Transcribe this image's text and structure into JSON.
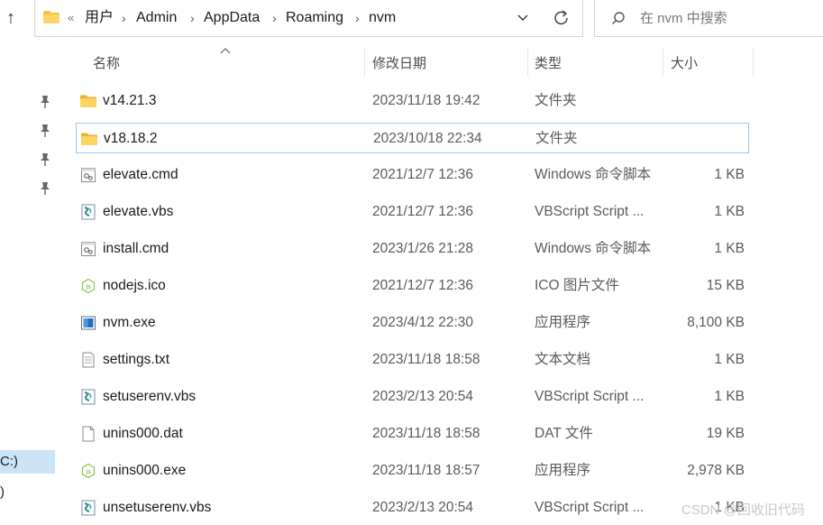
{
  "address": {
    "overflow": "«",
    "crumbs": [
      "用户",
      "Admin",
      "AppData",
      "Roaming",
      "nvm"
    ]
  },
  "search": {
    "placeholder": "在 nvm 中搜索"
  },
  "columns": {
    "name": "名称",
    "date": "修改日期",
    "type": "类型",
    "size": "大小"
  },
  "nav": {
    "drive_label": "C:)",
    "item2": ")"
  },
  "files": [
    {
      "name": "v14.21.3",
      "date": "2023/11/18 19:42",
      "type": "文件夹",
      "size": "",
      "icon": "folder-icon"
    },
    {
      "name": "v18.18.2",
      "date": "2023/10/18 22:34",
      "type": "文件夹",
      "size": "",
      "icon": "folder-icon"
    },
    {
      "name": "elevate.cmd",
      "date": "2021/12/7 12:36",
      "type": "Windows 命令脚本",
      "size": "1 KB",
      "icon": "cmd-file-icon"
    },
    {
      "name": "elevate.vbs",
      "date": "2021/12/7 12:36",
      "type": "VBScript Script ...",
      "size": "1 KB",
      "icon": "vbs-file-icon"
    },
    {
      "name": "install.cmd",
      "date": "2023/1/26 21:28",
      "type": "Windows 命令脚本",
      "size": "1 KB",
      "icon": "cmd-file-icon"
    },
    {
      "name": "nodejs.ico",
      "date": "2021/12/7 12:36",
      "type": "ICO 图片文件",
      "size": "15 KB",
      "icon": "nodejs-icon"
    },
    {
      "name": "nvm.exe",
      "date": "2023/4/12 22:30",
      "type": "应用程序",
      "size": "8,100 KB",
      "icon": "exe-icon"
    },
    {
      "name": "settings.txt",
      "date": "2023/11/18 18:58",
      "type": "文本文档",
      "size": "1 KB",
      "icon": "text-file-icon"
    },
    {
      "name": "setuserenv.vbs",
      "date": "2023/2/13 20:54",
      "type": "VBScript Script ...",
      "size": "1 KB",
      "icon": "vbs-file-icon"
    },
    {
      "name": "unins000.dat",
      "date": "2023/11/18 18:58",
      "type": "DAT 文件",
      "size": "19 KB",
      "icon": "blank-file-icon"
    },
    {
      "name": "unins000.exe",
      "date": "2023/11/18 18:57",
      "type": "应用程序",
      "size": "2,978 KB",
      "icon": "nodejs-icon"
    },
    {
      "name": "unsetuserenv.vbs",
      "date": "2023/2/13 20:54",
      "type": "VBScript Script ...",
      "size": "1 KB",
      "icon": "vbs-file-icon"
    }
  ],
  "watermark": "CSDN @回收旧代码",
  "colors": {
    "folder": "#f6c445",
    "selection_border": "#99c9ef",
    "nav_selected": "#cce4f7"
  }
}
